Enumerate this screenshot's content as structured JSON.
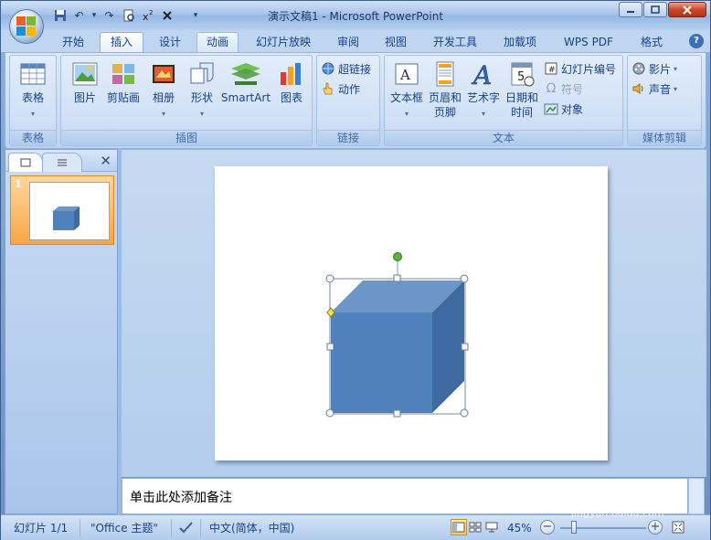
{
  "window": {
    "title": "演示文稿1 - Microsoft PowerPoint"
  },
  "qat": {
    "undo_glyph": "↶",
    "redo_glyph": "↷",
    "dropdown_glyph": "▾"
  },
  "tabs": [
    {
      "label": "开始"
    },
    {
      "label": "插入"
    },
    {
      "label": "设计"
    },
    {
      "label": "动画"
    },
    {
      "label": "幻灯片放映"
    },
    {
      "label": "审阅"
    },
    {
      "label": "视图"
    },
    {
      "label": "开发工具"
    },
    {
      "label": "加载项"
    },
    {
      "label": "WPS PDF"
    },
    {
      "label": "格式"
    }
  ],
  "active_tab": "插入",
  "ribbon": {
    "groups": {
      "table": {
        "label": "表格",
        "table_btn": "表格"
      },
      "illustrations": {
        "label": "插图",
        "picture": "图片",
        "clipart": "剪贴画",
        "album": "相册",
        "shapes": "形状",
        "smartart": "SmartArt",
        "chart": "图表"
      },
      "links": {
        "label": "链接",
        "hyperlink": "超链接",
        "action": "动作"
      },
      "text": {
        "label": "文本",
        "textbox": "文本框",
        "header_footer_1": "页眉和",
        "header_footer_2": "页脚",
        "wordart": "艺术字",
        "datetime_1": "日期和",
        "datetime_2": "时间",
        "slide_number": "幻灯片编号",
        "symbol": "符号",
        "object": "对象"
      },
      "media": {
        "label": "媒体剪辑",
        "movie": "影片",
        "sound": "声音"
      }
    }
  },
  "slides_pane": {
    "slide_number": "1"
  },
  "notes": {
    "placeholder": "单击此处添加备注"
  },
  "status": {
    "slide_info": "幻灯片 1/1",
    "theme": "\"Office 主题\"",
    "language": "中文(简体，中国)",
    "zoom": "45%"
  },
  "shape": {
    "front_color": "#4f81bd",
    "top_color": "#6d96c8",
    "side_color": "#3e6aa1",
    "handle_color": "#5eb33a",
    "adjust_color": "#f3df4a"
  },
  "watermark": {
    "main": "Baidu经验",
    "sub": "jingyan.baidu.com"
  }
}
